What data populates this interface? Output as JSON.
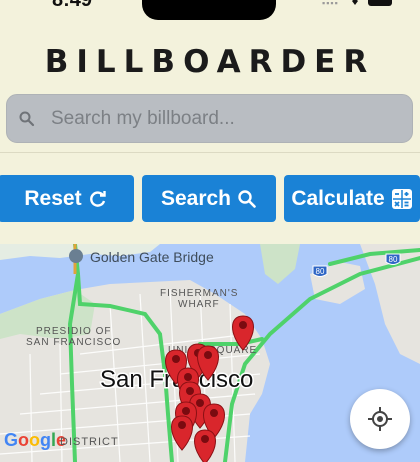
{
  "status": {
    "time": "8:49"
  },
  "app": {
    "title": "BILLBOARDER"
  },
  "search": {
    "placeholder": "Search my billboard..."
  },
  "buttons": {
    "reset": "Reset",
    "search": "Search",
    "calculate": "Calculate"
  },
  "map": {
    "labels": {
      "golden_gate": "Golden Gate Bridge",
      "fishermans_1": "FISHERMAN'S",
      "fishermans_2": "WHARF",
      "presidio_1": "PRESIDIO OF",
      "presidio_2": "SAN FRANCISCO",
      "union_square": "UNION SQUARE",
      "city": "San Francisco",
      "district": "DISTRICT",
      "highway_1": "80",
      "highway_2": "80"
    },
    "google": "Google",
    "pin_color": "#d9262c",
    "road_color": "#4fd26a",
    "water_color": "#aecbfa"
  }
}
